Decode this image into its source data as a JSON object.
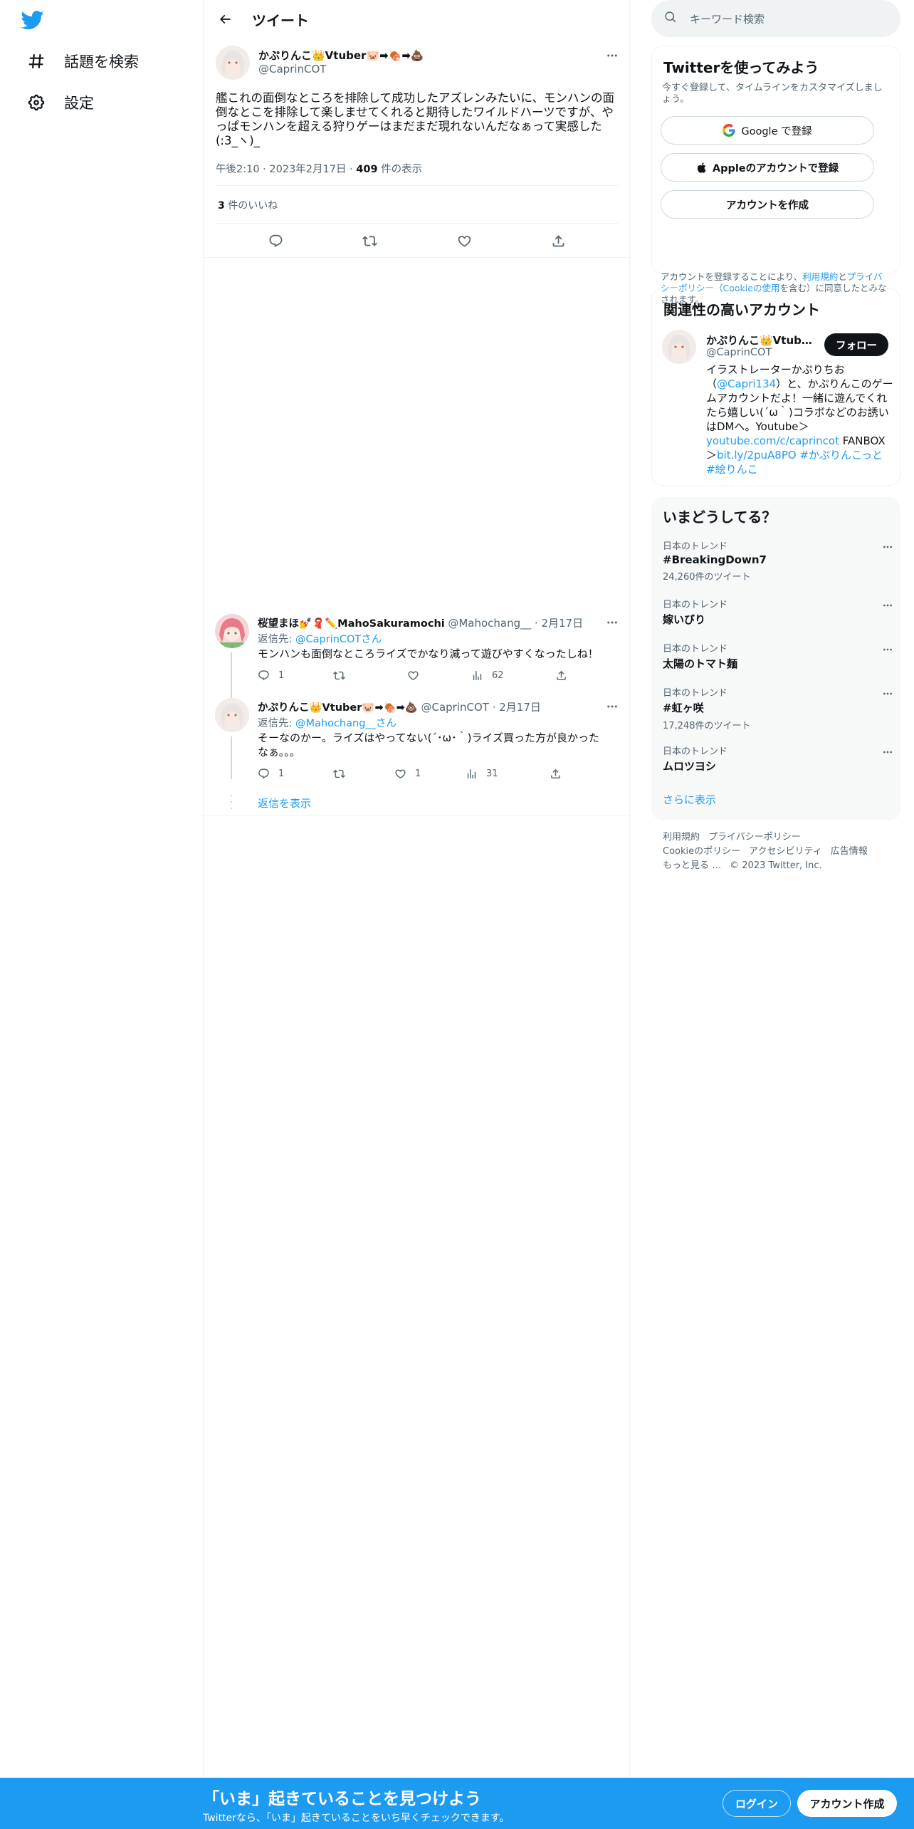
{
  "nav": {
    "explore_label": "話題を検索",
    "settings_label": "設定"
  },
  "header": {
    "title": "ツイート"
  },
  "tweet": {
    "author_name": "かぷりんこ👑Vtuber🐷➡🍖➡💩",
    "author_handle": "@CaprinCOT",
    "text": "艦これの面倒なところを排除して成功したアズレンみたいに、モンハンの面倒なとこを排除して楽しませてくれると期待したワイルドハーツですが、やっぱモンハンを超える狩りゲーはまだまだ現れないんだなぁって実感した(:3_ヽ)_",
    "time": "午後2:10",
    "date": "2023年2月17日",
    "views_count": "409",
    "views_label": " 件の表示",
    "likes_count": "3",
    "likes_label": " 件のいいね"
  },
  "replies": [
    {
      "name": "桜望まほ💅🧣✏️MahoSakuramochi",
      "handle": "@Mahochang__",
      "date": "2月17日",
      "reply_to_label": "返信先: ",
      "reply_to": "@CaprinCOTさん",
      "text": "モンハンも面倒なところライズでかなり減って遊びやすくなったしね！",
      "reply_count": "1",
      "retweet_count": "",
      "like_count": "",
      "view_count": "62"
    },
    {
      "name": "かぷりんこ👑Vtuber🐷➡🍖➡💩",
      "handle": "@CaprinCOT",
      "date": "2月17日",
      "reply_to_label": "返信先: ",
      "reply_to": "@Mahochang__さん",
      "text": "そーなのかー。ライズはやってない(´･ω･｀)ライズ買った方が良かったなぁ。。。",
      "reply_count": "1",
      "retweet_count": "",
      "like_count": "1",
      "view_count": "31"
    }
  ],
  "show_replies": "返信を表示",
  "sidebar": {
    "search_placeholder": "キーワード検索",
    "signup_card": {
      "title": "Twitterを使ってみよう",
      "subtitle": "今すぐ登録して、タイムラインをカスタマイズしましょう。",
      "google_button": "Google で登録",
      "apple_button": "Appleのアカウントで登録",
      "create_button": "アカウントを作成",
      "legal_prefix": "アカウントを登録することにより、",
      "legal_terms": "利用規約",
      "legal_and": "と",
      "legal_privacy": "プライバシーポリシー",
      "legal_cookie": "（Cookieの使用",
      "legal_suffix": "を含む）に同意したとみなされます。"
    },
    "related": {
      "title": "関連性の高いアカウント",
      "name": "かぷりんこ👑Vtuber🐷➡🍖➡💩",
      "handle": "@CaprinCOT",
      "follow_button": "フォロー",
      "bio_1": "イラストレーターかぷりちお（",
      "bio_mention": "@Capri134",
      "bio_2": "）と、かぷりんこのゲームアカウントだよ！一緒に遊んでくれたら嬉しい(´ω｀)コラボなどのお誘いはDMへ。Youtube＞",
      "bio_link1": "youtube.com/c/caprincot",
      "bio_3": " FANBOX＞",
      "bio_link2": "bit.ly/2puA8PO",
      "bio_tags": " #かぷりんこっと #絵りんこ"
    },
    "trends_title": "いまどうしてる？",
    "trends": [
      {
        "context": "日本のトレンド",
        "name": "#BreakingDown7",
        "count": "24,260件のツイート"
      },
      {
        "context": "日本のトレンド",
        "name": "嫁いびり",
        "count": ""
      },
      {
        "context": "日本のトレンド",
        "name": "太陽のトマト麺",
        "count": ""
      },
      {
        "context": "日本のトレンド",
        "name": "#虹ヶ咲",
        "count": "17,248件のツイート"
      },
      {
        "context": "日本のトレンド",
        "name": "ムロツヨシ",
        "count": ""
      }
    ],
    "show_more": "さらに表示",
    "footer": [
      "利用規約",
      "プライバシーポリシー",
      "Cookieのポリシー",
      "アクセシビリティ",
      "広告情報",
      "もっと見る …",
      "© 2023 Twitter, Inc."
    ]
  },
  "bottom_bar": {
    "title": "「いま」起きていることを見つけよう",
    "subtitle": "Twitterなら、「いま」起きていることをいち早くチェックできます。",
    "login": "ログイン",
    "signup": "アカウント作成"
  },
  "colors": {
    "accent": "#1d9bf0",
    "text": "#0f1419",
    "secondary": "#536471"
  }
}
